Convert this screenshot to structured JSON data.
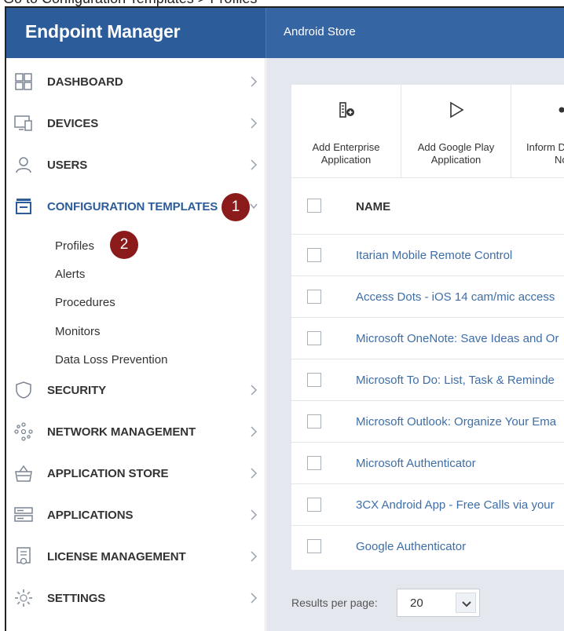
{
  "instruction_fragment": "Go to Configuration Templates > Profiles",
  "header": {
    "app_title": "Endpoint Manager",
    "page_title": "Android Store"
  },
  "sidebar": {
    "items": [
      {
        "label": "DASHBOARD",
        "icon": "dashboard-icon"
      },
      {
        "label": "DEVICES",
        "icon": "devices-icon"
      },
      {
        "label": "USERS",
        "icon": "user-icon"
      },
      {
        "label": "CONFIGURATION TEMPLATES",
        "icon": "configuration-icon"
      },
      {
        "label": "SECURITY",
        "icon": "shield-icon"
      },
      {
        "label": "NETWORK MANAGEMENT",
        "icon": "network-icon"
      },
      {
        "label": "APPLICATION STORE",
        "icon": "store-icon"
      },
      {
        "label": "APPLICATIONS",
        "icon": "applications-icon"
      },
      {
        "label": "LICENSE MANAGEMENT",
        "icon": "license-icon"
      },
      {
        "label": "SETTINGS",
        "icon": "gear-icon"
      }
    ],
    "sub_items": [
      "Profiles",
      "Alerts",
      "Procedures",
      "Monitors",
      "Data Loss Prevention"
    ],
    "badges": [
      "1",
      "2"
    ]
  },
  "toolbar": {
    "buttons": [
      {
        "label_line1": "Add Enterprise",
        "label_line2": "Application",
        "icon": "enterprise-app-icon"
      },
      {
        "label_line1": "Add Google Play",
        "label_line2": "Application",
        "icon": "play-icon"
      },
      {
        "label_line1": "Inform D",
        "label_line2": "No",
        "icon": "share-icon"
      }
    ]
  },
  "table": {
    "column_name": "NAME",
    "rows": [
      "Itarian Mobile Remote Control",
      "Access Dots - iOS 14 cam/mic access",
      "Microsoft OneNote: Save Ideas and Or",
      "Microsoft To Do: List, Task & Reminde",
      "Microsoft Outlook: Organize Your Ema",
      "Microsoft Authenticator",
      "3CX Android App - Free Calls via your",
      "Google Authenticator"
    ]
  },
  "pagination": {
    "label": "Results per page:",
    "value": "20"
  },
  "colors": {
    "header": "#2c5c99",
    "link": "#3e6ea8",
    "badge": "#8b1a1a",
    "content_bg": "#e4e8ee"
  }
}
